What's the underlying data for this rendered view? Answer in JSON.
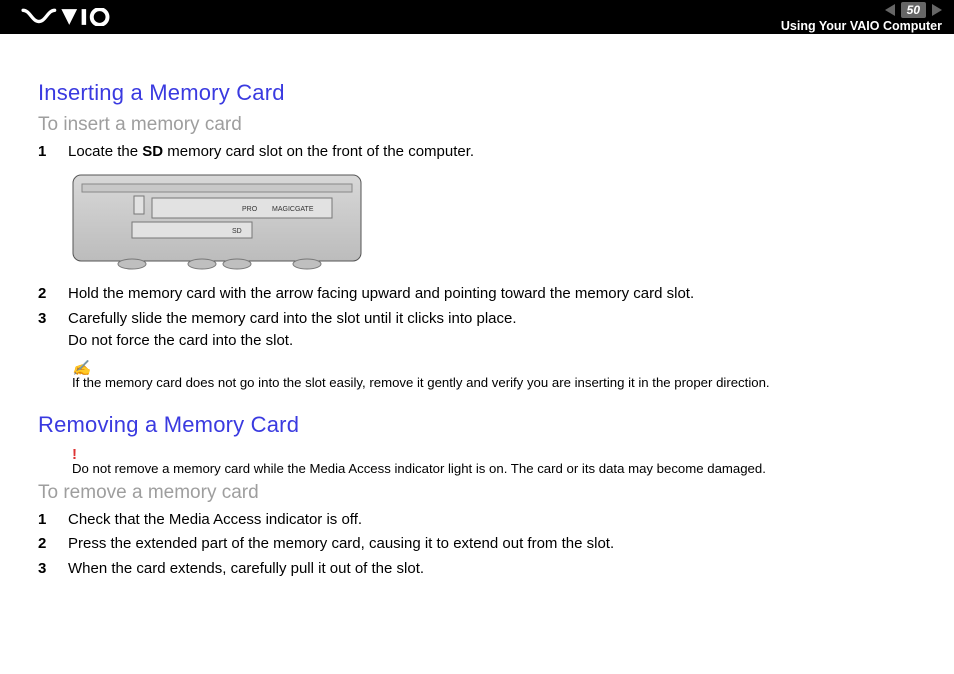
{
  "header": {
    "page_number": "50",
    "section": "Using Your VAIO Computer",
    "logo_name": "vaio-logo"
  },
  "sections": {
    "insert": {
      "title": "Inserting a Memory Card",
      "subtitle": "To insert a memory card",
      "steps": [
        {
          "n": "1",
          "text_pre": "Locate the ",
          "bold": "SD",
          "text_post": " memory card slot on the front of the computer."
        },
        {
          "n": "2",
          "text": "Hold the memory card with the arrow facing upward and pointing toward the memory card slot."
        },
        {
          "n": "3",
          "text": "Carefully slide the memory card into the slot until it clicks into place.",
          "sub": "Do not force the card into the slot."
        }
      ],
      "note": "If the memory card does not go into the slot easily, remove it gently and verify you are inserting it in the proper direction.",
      "illus_labels": {
        "pro": "PRO",
        "magicgate": "MAGICGATE",
        "sd": "SD"
      }
    },
    "remove": {
      "title": "Removing a Memory Card",
      "warning": "Do not remove a memory card while the Media Access indicator light is on. The card or its data may become damaged.",
      "subtitle": "To remove a memory card",
      "steps": [
        {
          "n": "1",
          "text": "Check that the Media Access indicator is off."
        },
        {
          "n": "2",
          "text": "Press the extended part of the memory card, causing it to extend out from the slot."
        },
        {
          "n": "3",
          "text": "When the card extends, carefully pull it out of the slot."
        }
      ]
    }
  }
}
